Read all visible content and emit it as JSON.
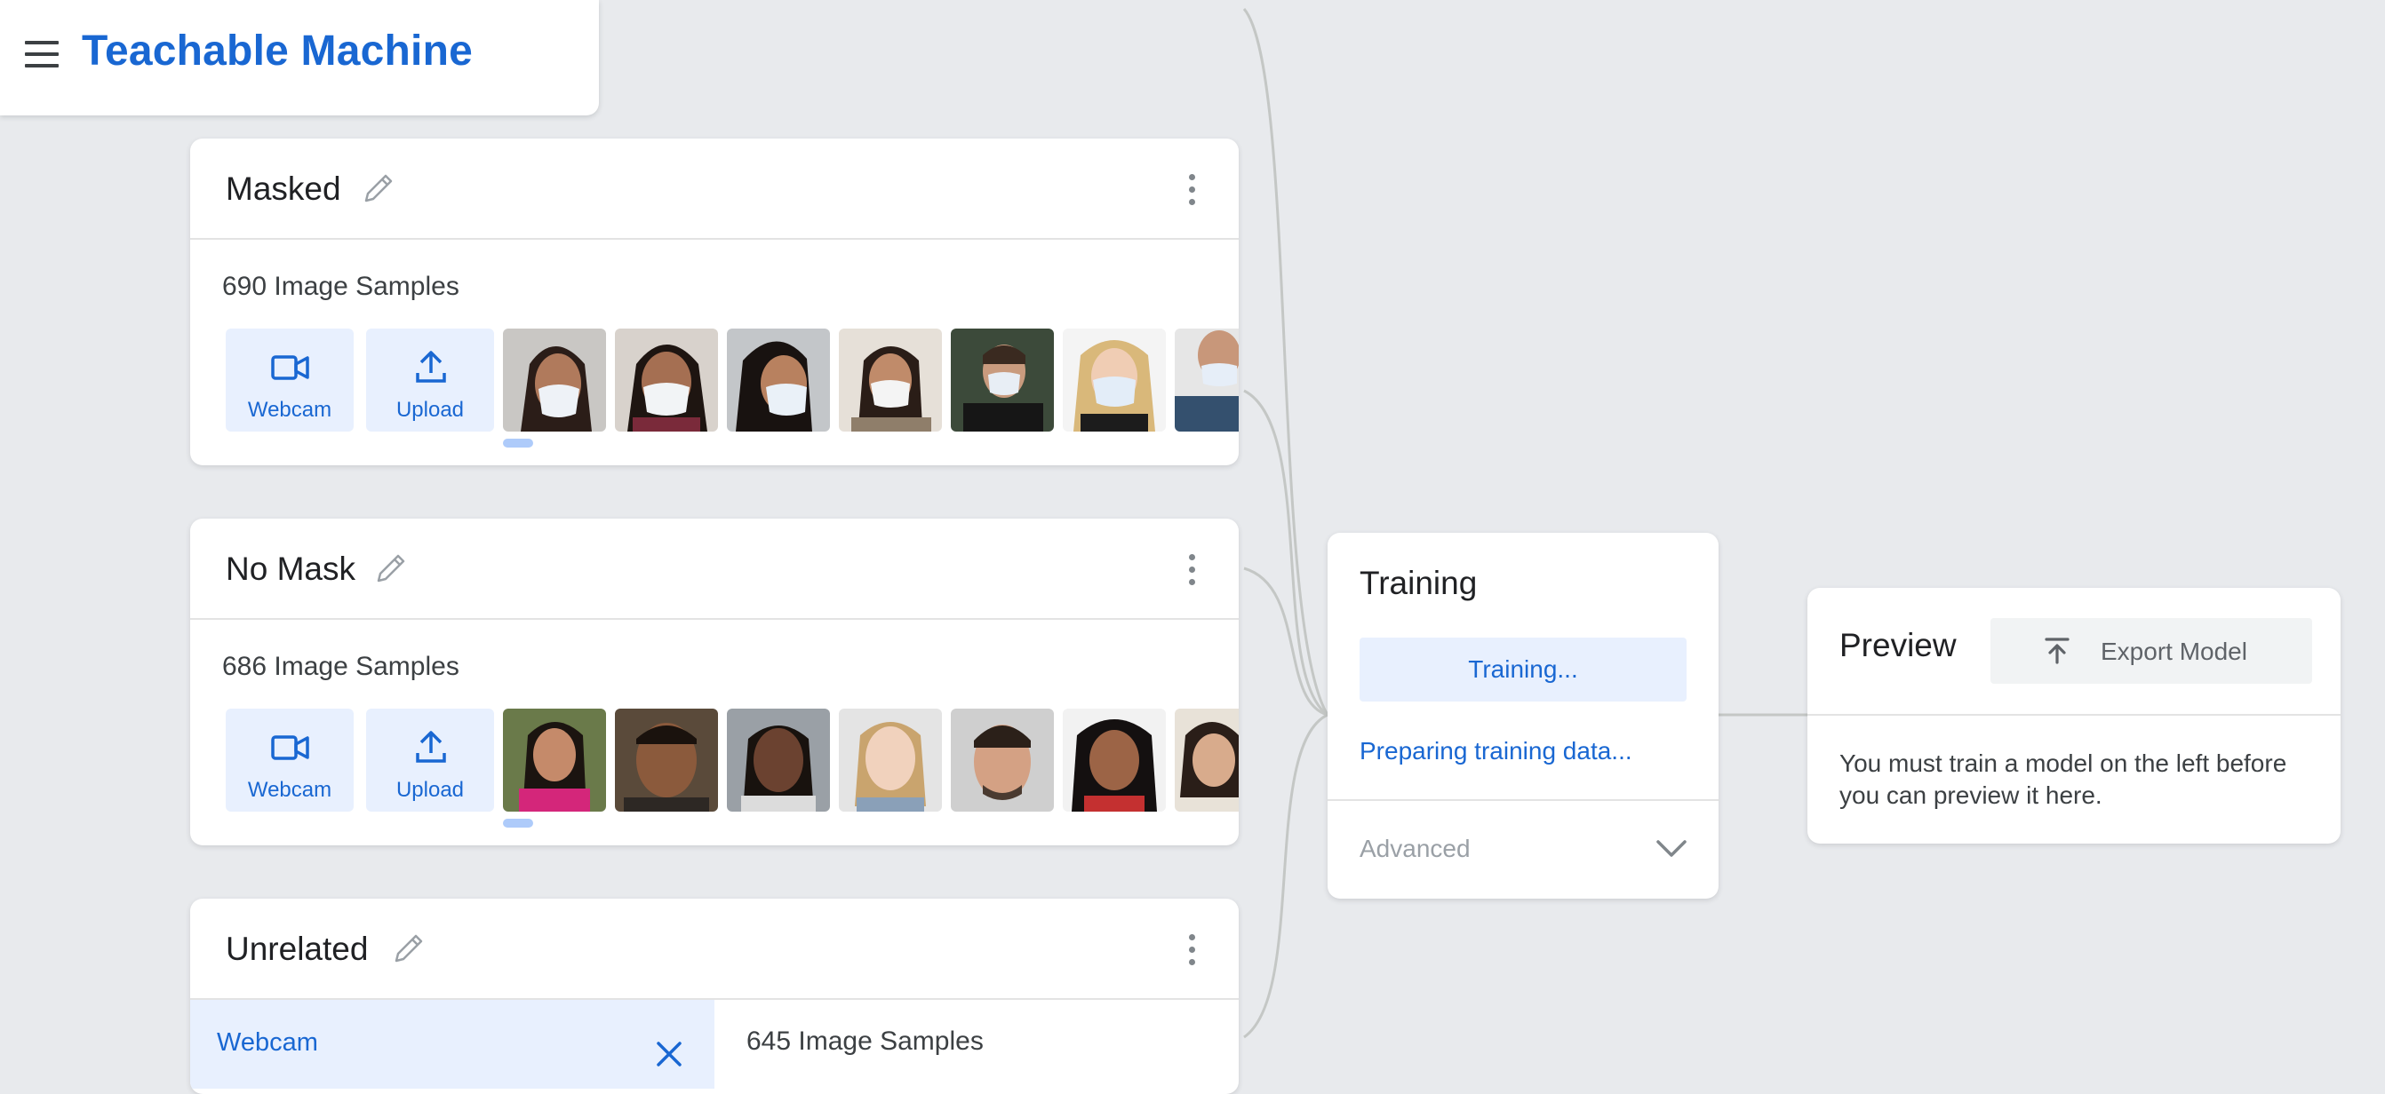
{
  "app": {
    "title": "Teachable Machine"
  },
  "classes": [
    {
      "name": "Masked",
      "sample_count": "690 Image Samples",
      "webcam_label": "Webcam",
      "upload_label": "Upload",
      "thumbnails": [
        "masked-woman-thumbnail",
        "masked-woman-thumbnail",
        "masked-woman-thumbnail",
        "masked-woman-thumbnail",
        "masked-man-thumbnail",
        "masked-woman-thumbnail",
        "masked-man-thumbnail"
      ]
    },
    {
      "name": "No Mask",
      "sample_count": "686 Image Samples",
      "webcam_label": "Webcam",
      "upload_label": "Upload",
      "thumbnails": [
        "face-thumbnail",
        "face-thumbnail",
        "face-thumbnail",
        "face-thumbnail",
        "face-thumbnail",
        "face-thumbnail",
        "face-thumbnail"
      ]
    },
    {
      "name": "Unrelated",
      "sample_count": "645 Image Samples",
      "webcam_label": "Webcam"
    }
  ],
  "training": {
    "title": "Training",
    "button_label": "Training...",
    "status": "Preparing training data...",
    "advanced_label": "Advanced"
  },
  "preview": {
    "title": "Preview",
    "export_label": "Export Model",
    "message": "You must train a model on the left before you can preview it here."
  },
  "colors": {
    "accent": "#1967d2",
    "accent_bg": "#e8f0fe",
    "background": "#e8eaed"
  }
}
